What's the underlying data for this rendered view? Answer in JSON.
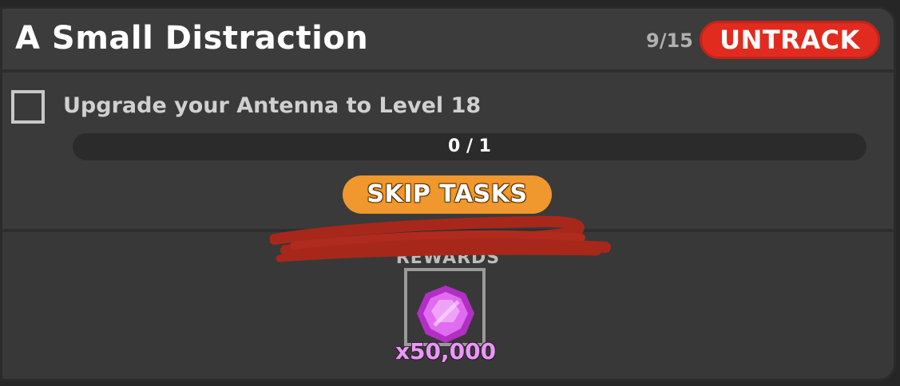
{
  "quest": {
    "title": "A Small Distraction",
    "counter": "9/15",
    "untrack_label": "UNTRACK"
  },
  "task": {
    "label": "Upgrade your Antenna to Level 18",
    "progress_text": "0 / 1",
    "progress_fraction": 0
  },
  "skip_label": "SKIP TASKS",
  "rewards": {
    "label": "REWARDS",
    "items": [
      {
        "icon": "pink-gem-icon",
        "amount": "x50,000"
      }
    ]
  },
  "colors": {
    "untrack": "#e22b1f",
    "skip": "#f0972d",
    "gem": "#d84be6",
    "scribble": "#a8271b"
  }
}
